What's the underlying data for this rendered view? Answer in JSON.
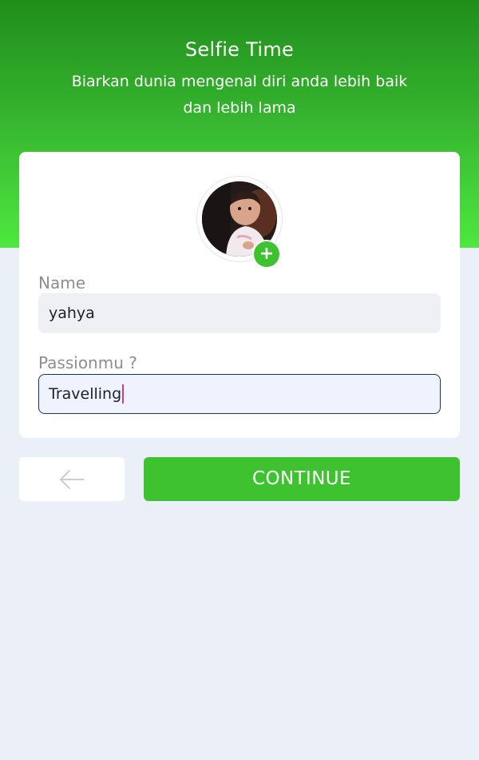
{
  "header": {
    "title": "Selfie Time",
    "subtitle": "Biarkan dunia mengenal diri anda lebih baik dan lebih lama"
  },
  "profile": {
    "avatar_icon": "child-photo",
    "add_icon_glyph": "+"
  },
  "form": {
    "name_label": "Name",
    "name_value": "yahya",
    "passion_label": "Passionmu ?",
    "passion_value": "Travelling"
  },
  "actions": {
    "back_icon": "arrow-left-icon",
    "continue_label": "CONTINUE"
  },
  "colors": {
    "accent": "#3ec230",
    "background": "#ebeff8",
    "focus_border": "#1c2f7a"
  }
}
